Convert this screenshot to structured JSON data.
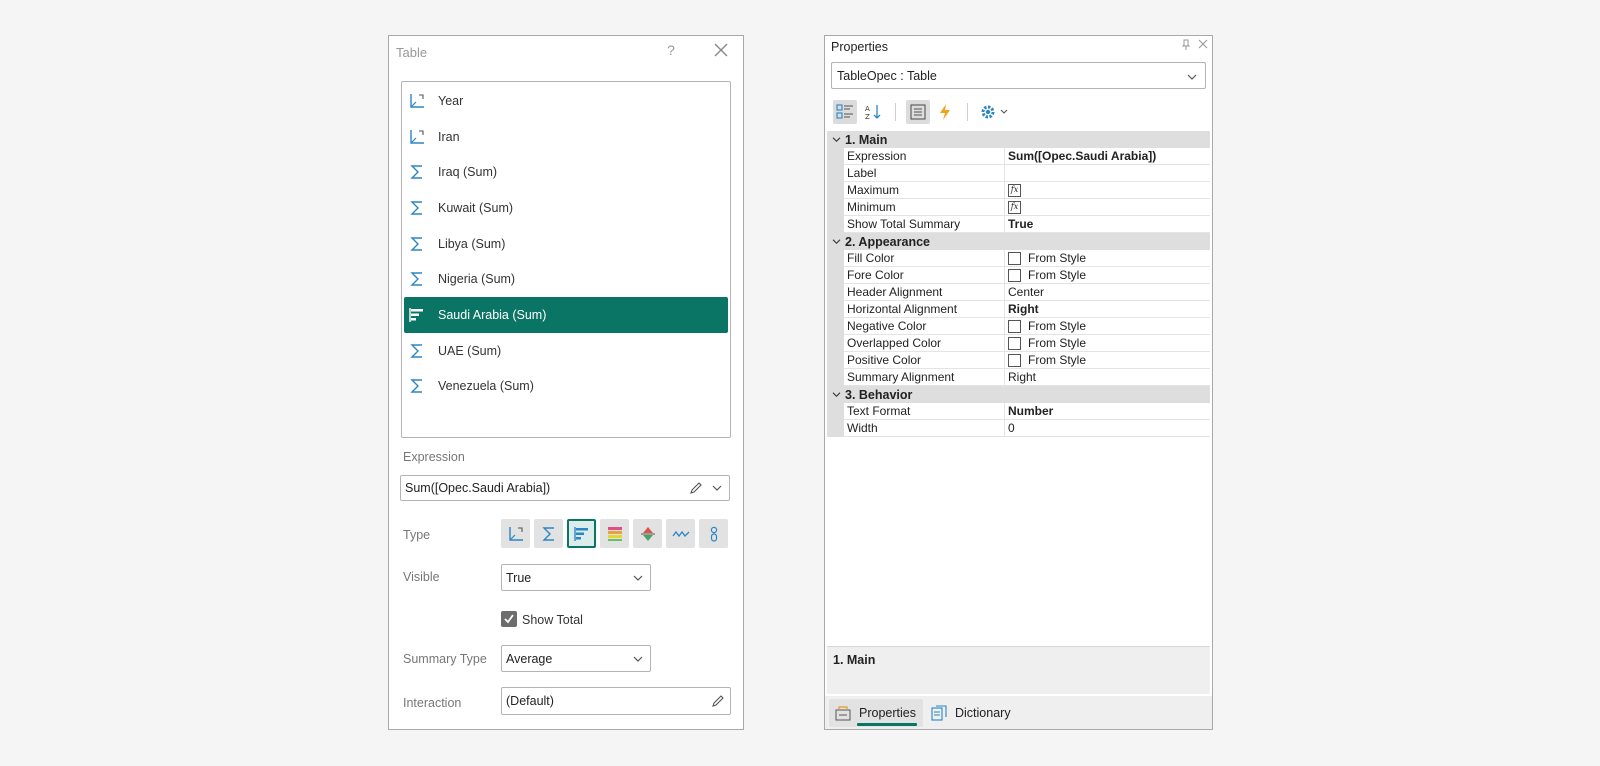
{
  "dialog": {
    "title": "Table",
    "help": "?",
    "columns": [
      {
        "label": "Year",
        "icon": "dimension-icon"
      },
      {
        "label": "Iran",
        "icon": "dimension-icon"
      },
      {
        "label": "Iraq (Sum)",
        "icon": "sum-icon"
      },
      {
        "label": "Kuwait (Sum)",
        "icon": "sum-icon"
      },
      {
        "label": "Libya (Sum)",
        "icon": "sum-icon"
      },
      {
        "label": "Nigeria (Sum)",
        "icon": "sum-icon"
      },
      {
        "label": "Saudi Arabia (Sum)",
        "icon": "bar-indicator-icon",
        "selected": true
      },
      {
        "label": "UAE (Sum)",
        "icon": "sum-icon"
      },
      {
        "label": "Venezuela (Sum)",
        "icon": "sum-icon"
      }
    ],
    "expression_label": "Expression",
    "expression_value": "Sum([Opec.Saudi Arabia])",
    "type_label": "Type",
    "type_buttons": [
      "dimension-type-icon",
      "measure-type-icon",
      "data-bars-type-icon",
      "color-scale-type-icon",
      "indicator-type-icon",
      "sparklines-type-icon",
      "bubble-type-icon"
    ],
    "visible_label": "Visible",
    "visible_value": "True",
    "show_total_label": "Show Total",
    "show_total_checked": true,
    "summary_type_label": "Summary Type",
    "summary_type_value": "Average",
    "interaction_label": "Interaction",
    "interaction_value": "(Default)",
    "accent": "#0a7565"
  },
  "properties": {
    "title": "Properties",
    "object": "TableOpec : Table",
    "toolbar": [
      "categorized-icon",
      "alphabetical-icon",
      "properties-icon",
      "events-icon",
      "settings-icon"
    ],
    "categories": [
      {
        "name": "1. Main",
        "rows": [
          {
            "key": "Expression",
            "value": "Sum([Opec.Saudi Arabia])",
            "bold": true
          },
          {
            "key": "Label",
            "value": ""
          },
          {
            "key": "Maximum",
            "value": "",
            "fx": true
          },
          {
            "key": "Minimum",
            "value": "",
            "fx": true
          },
          {
            "key": "Show Total Summary",
            "value": "True",
            "bold": true
          }
        ]
      },
      {
        "name": "2. Appearance",
        "rows": [
          {
            "key": "Fill Color",
            "value": "From Style",
            "swatch": true
          },
          {
            "key": "Fore Color",
            "value": "From Style",
            "swatch": true
          },
          {
            "key": "Header Alignment",
            "value": "Center"
          },
          {
            "key": "Horizontal Alignment",
            "value": "Right",
            "bold": true
          },
          {
            "key": "Negative Color",
            "value": "From Style",
            "swatch": true
          },
          {
            "key": "Overlapped Color",
            "value": "From Style",
            "swatch": true
          },
          {
            "key": "Positive Color",
            "value": "From Style",
            "swatch": true
          },
          {
            "key": "Summary Alignment",
            "value": "Right"
          }
        ]
      },
      {
        "name": "3. Behavior",
        "rows": [
          {
            "key": "Text Format",
            "value": "Number",
            "bold": true
          },
          {
            "key": "Width",
            "value": "0"
          }
        ]
      }
    ],
    "description": "1. Main",
    "tabs": {
      "properties": "Properties",
      "dictionary": "Dictionary"
    }
  }
}
